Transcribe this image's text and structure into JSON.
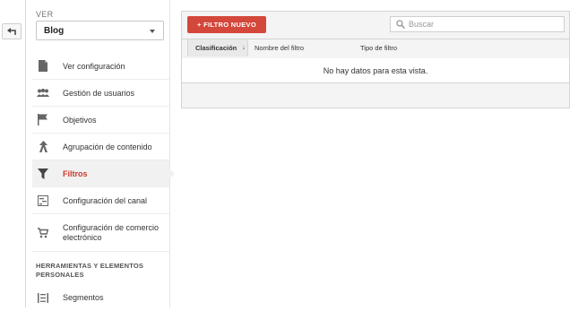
{
  "sidebar": {
    "view_label": "VER",
    "view_selected": "Blog",
    "items": [
      {
        "label": "Ver configuración",
        "icon": "document-icon"
      },
      {
        "label": "Gestión de usuarios",
        "icon": "users-icon"
      },
      {
        "label": "Objetivos",
        "icon": "flag-icon"
      },
      {
        "label": "Agrupación de contenido",
        "icon": "content-grouping-icon"
      },
      {
        "label": "Filtros",
        "icon": "filter-icon",
        "active": true
      },
      {
        "label": "Configuración del canal",
        "icon": "channel-settings-icon"
      },
      {
        "label": "Configuración de comercio electrónico",
        "icon": "cart-icon"
      }
    ],
    "section_heading": "HERRAMIENTAS Y ELEMENTOS PERSONALES",
    "tools": [
      {
        "label": "Segmentos",
        "icon": "segments-icon"
      }
    ]
  },
  "toolbar": {
    "add_filter_label": "+ FILTRO NUEVO",
    "search_placeholder": "Buscar"
  },
  "table": {
    "columns": [
      "Clasificación",
      "Nombre del filtro",
      "Tipo de filtro"
    ],
    "sort_arrow": "↓",
    "empty_message": "No hay datos para esta vista."
  },
  "colors": {
    "accent": "#d4473b",
    "active_text": "#c9392c",
    "active_bg": "#f1f1f1"
  }
}
